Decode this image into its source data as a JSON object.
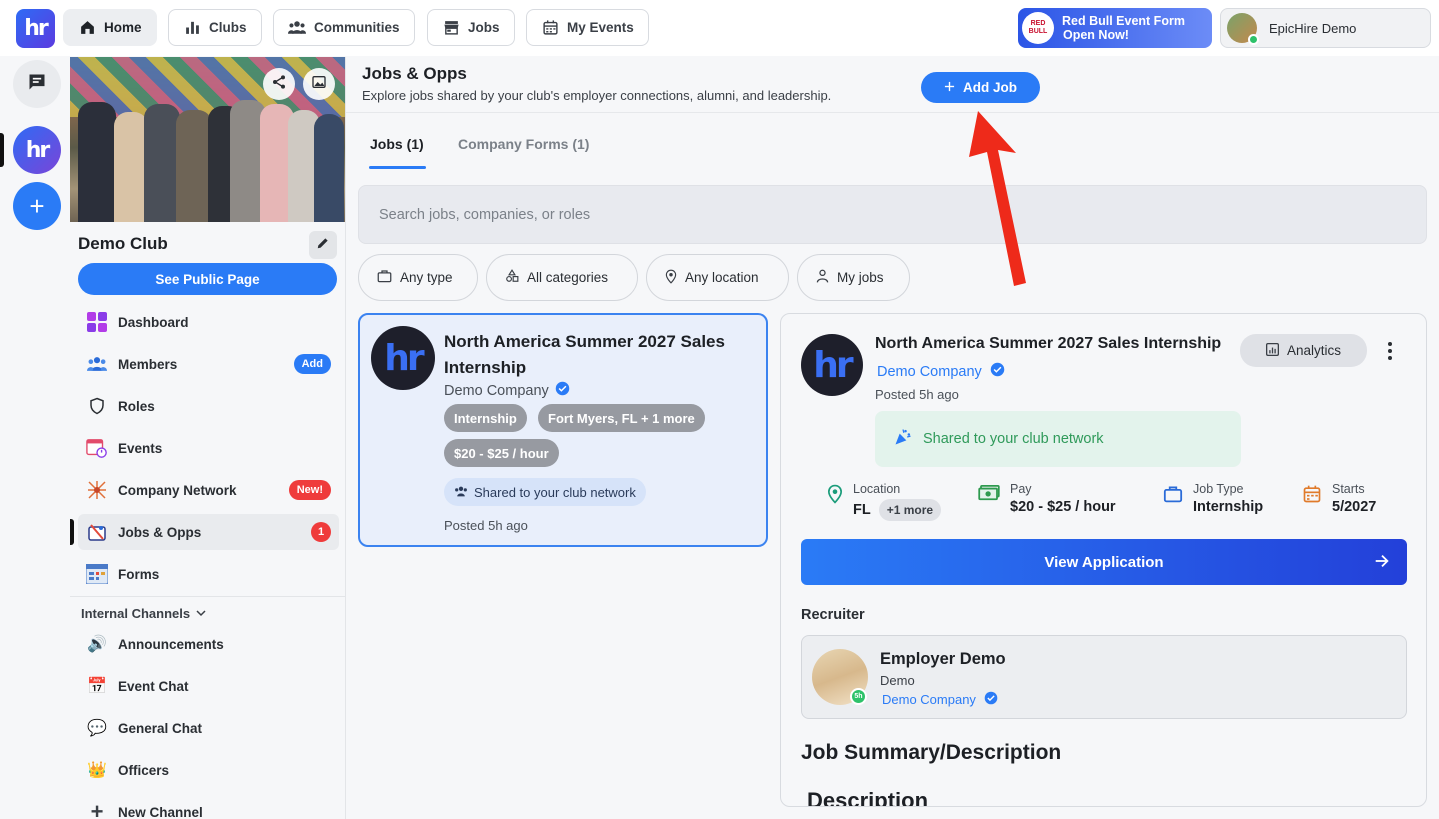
{
  "topnav": {
    "logo_text": "hr",
    "items": [
      {
        "label": "Home",
        "icon": "home-icon",
        "active": true
      },
      {
        "label": "Clubs",
        "icon": "bar-chart-icon"
      },
      {
        "label": "Communities",
        "icon": "people-icon"
      },
      {
        "label": "Jobs",
        "icon": "store-icon"
      },
      {
        "label": "My Events",
        "icon": "calendar-icon"
      }
    ],
    "promo": {
      "line1": "Red Bull Event Form",
      "line2": "Open Now!",
      "badge_text": "RED BULL"
    },
    "user": {
      "name": "EpicHire Demo"
    }
  },
  "rail": {
    "club_logo_text": "hr",
    "add_symbol": "+"
  },
  "club": {
    "name": "Demo Club",
    "public_button": "See Public Page",
    "menu": [
      {
        "label": "Dashboard",
        "icon": "dashboard-icon"
      },
      {
        "label": "Members",
        "icon": "members-icon",
        "badge": "Add"
      },
      {
        "label": "Roles",
        "icon": "shield-icon"
      },
      {
        "label": "Events",
        "icon": "calendar-clock-icon"
      },
      {
        "label": "Company Network",
        "icon": "network-icon",
        "badge": "New!"
      },
      {
        "label": "Jobs & Opps",
        "icon": "jobs-icon",
        "badge": "1",
        "active": true
      },
      {
        "label": "Forms",
        "icon": "forms-icon"
      }
    ],
    "channels_header": "Internal Channels",
    "channels": [
      {
        "label": "Announcements",
        "icon": "megaphone-icon",
        "glyph": "🔊"
      },
      {
        "label": "Event Chat",
        "icon": "calendar-icon",
        "glyph": "📅"
      },
      {
        "label": "General Chat",
        "icon": "speech-bubble-icon",
        "glyph": "💬"
      },
      {
        "label": "Officers",
        "icon": "crown-icon",
        "glyph": "👑"
      },
      {
        "label": "New Channel",
        "icon": "plus-icon",
        "glyph": "+"
      }
    ]
  },
  "main": {
    "title": "Jobs & Opps",
    "subtitle": "Explore jobs shared by your club's employer connections, alumni, and leadership.",
    "add_job": "Add Job",
    "tabs": [
      {
        "label": "Jobs (1)",
        "active": true
      },
      {
        "label": "Company Forms (1)"
      }
    ],
    "search_placeholder": "Search jobs, companies, or roles",
    "filters": [
      {
        "label": "Any type",
        "icon": "briefcase-icon"
      },
      {
        "label": "All categories",
        "icon": "shapes-icon"
      },
      {
        "label": "Any location",
        "icon": "pin-icon"
      },
      {
        "label": "My jobs",
        "icon": "person-icon"
      }
    ]
  },
  "job_card": {
    "title": "North America Summer 2027 Sales Internship",
    "company": "Demo Company",
    "chips": [
      "Internship",
      "Fort Myers, FL + 1 more",
      "$20 - $25 / hour"
    ],
    "shared": "Shared to your club network",
    "posted": "Posted 5h ago"
  },
  "detail": {
    "title": "North America Summer 2027 Sales Internship",
    "company": "Demo Company",
    "posted": "Posted 5h ago",
    "analytics": "Analytics",
    "shared": "Shared to your club network",
    "meta": [
      {
        "label": "Location",
        "value": "FL",
        "extra": "+1 more",
        "icon": "location-pin-icon",
        "color": "#1a9c7a"
      },
      {
        "label": "Pay",
        "value": "$20 - $25 / hour",
        "icon": "money-icon",
        "color": "#2e9a4f"
      },
      {
        "label": "Job Type",
        "value": "Internship",
        "icon": "briefcase-icon",
        "color": "#2a6bd8"
      },
      {
        "label": "Starts",
        "value": "5/2027",
        "icon": "calendar-icon",
        "color": "#e07a2a"
      }
    ],
    "view_application": "View Application",
    "recruiter_label": "Recruiter",
    "recruiter": {
      "name": "Employer Demo",
      "role": "Demo",
      "company": "Demo Company",
      "badge": "5h"
    },
    "summary_heading": "Job Summary/Description",
    "description_heading": "Description"
  }
}
